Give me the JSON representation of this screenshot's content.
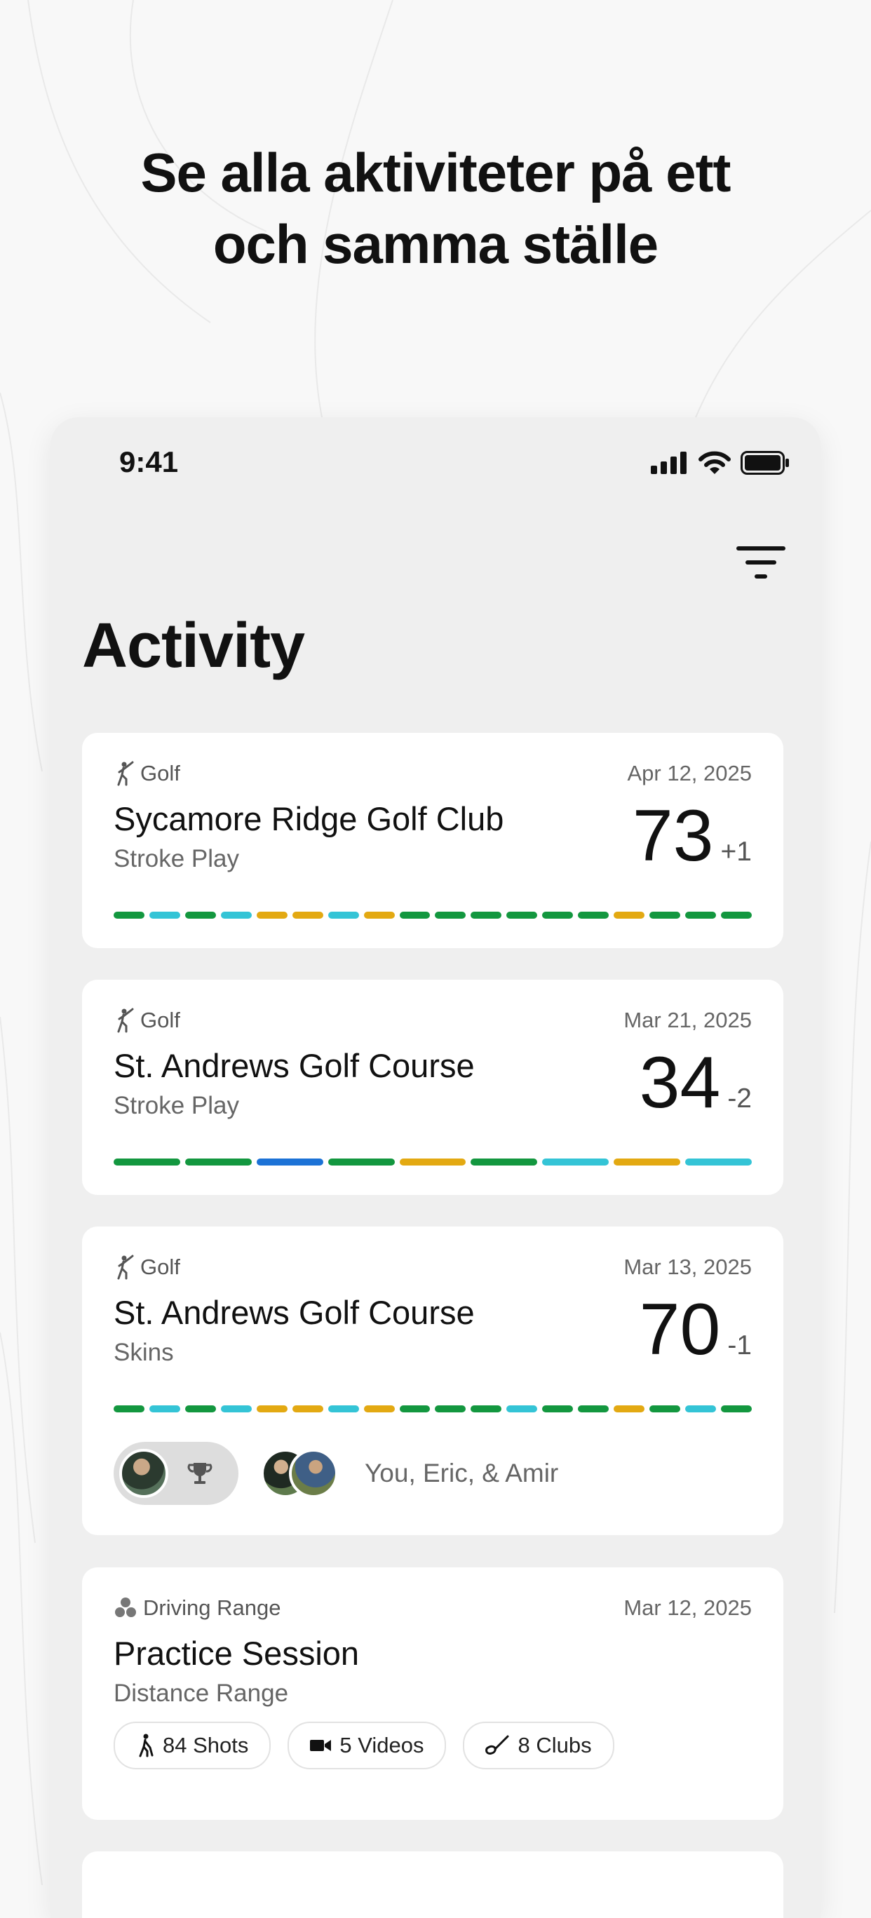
{
  "headline": {
    "line1": "Se alla aktiviteter på ett",
    "line2": "och samma ställe"
  },
  "status_bar": {
    "time": "9:41"
  },
  "page": {
    "title": "Activity"
  },
  "colors": {
    "green": "#13973f",
    "cyan": "#34c4d6",
    "yellow": "#e3a912",
    "blue": "#1c72d6"
  },
  "activities": [
    {
      "sport": "Golf",
      "sport_icon": "golfer-icon",
      "date": "Apr 12, 2025",
      "course": "Sycamore Ridge Golf Club",
      "mode": "Stroke Play",
      "score": "73",
      "diff": "+1",
      "holes": [
        "green",
        "cyan",
        "green",
        "cyan",
        "yellow",
        "yellow",
        "cyan",
        "yellow",
        "green",
        "green",
        "green",
        "green",
        "green",
        "green",
        "yellow",
        "green",
        "green",
        "green"
      ]
    },
    {
      "sport": "Golf",
      "sport_icon": "golfer-icon",
      "date": "Mar 21, 2025",
      "course": "St. Andrews Golf Course",
      "mode": "Stroke Play",
      "score": "34",
      "diff": "-2",
      "holes": [
        "green",
        "green",
        "blue",
        "green",
        "yellow",
        "green",
        "cyan",
        "yellow",
        "cyan"
      ]
    },
    {
      "sport": "Golf",
      "sport_icon": "golfer-icon",
      "date": "Mar 13, 2025",
      "course": "St. Andrews Golf Course",
      "mode": "Skins",
      "score": "70",
      "diff": "-1",
      "holes": [
        "green",
        "cyan",
        "green",
        "cyan",
        "yellow",
        "yellow",
        "cyan",
        "yellow",
        "green",
        "green",
        "green",
        "cyan",
        "green",
        "green",
        "yellow",
        "green",
        "cyan",
        "green"
      ],
      "players": "You, Eric, & Amir"
    },
    {
      "sport": "Driving Range",
      "sport_icon": "golf-balls-icon",
      "date": "Mar 12, 2025",
      "course": "Practice Session",
      "mode": "Distance Range",
      "chips": [
        {
          "label": "84 Shots",
          "icon": "golfer-swing-icon"
        },
        {
          "label": "5 Videos",
          "icon": "video-camera-icon"
        },
        {
          "label": "8 Clubs",
          "icon": "golf-club-icon"
        }
      ]
    }
  ]
}
